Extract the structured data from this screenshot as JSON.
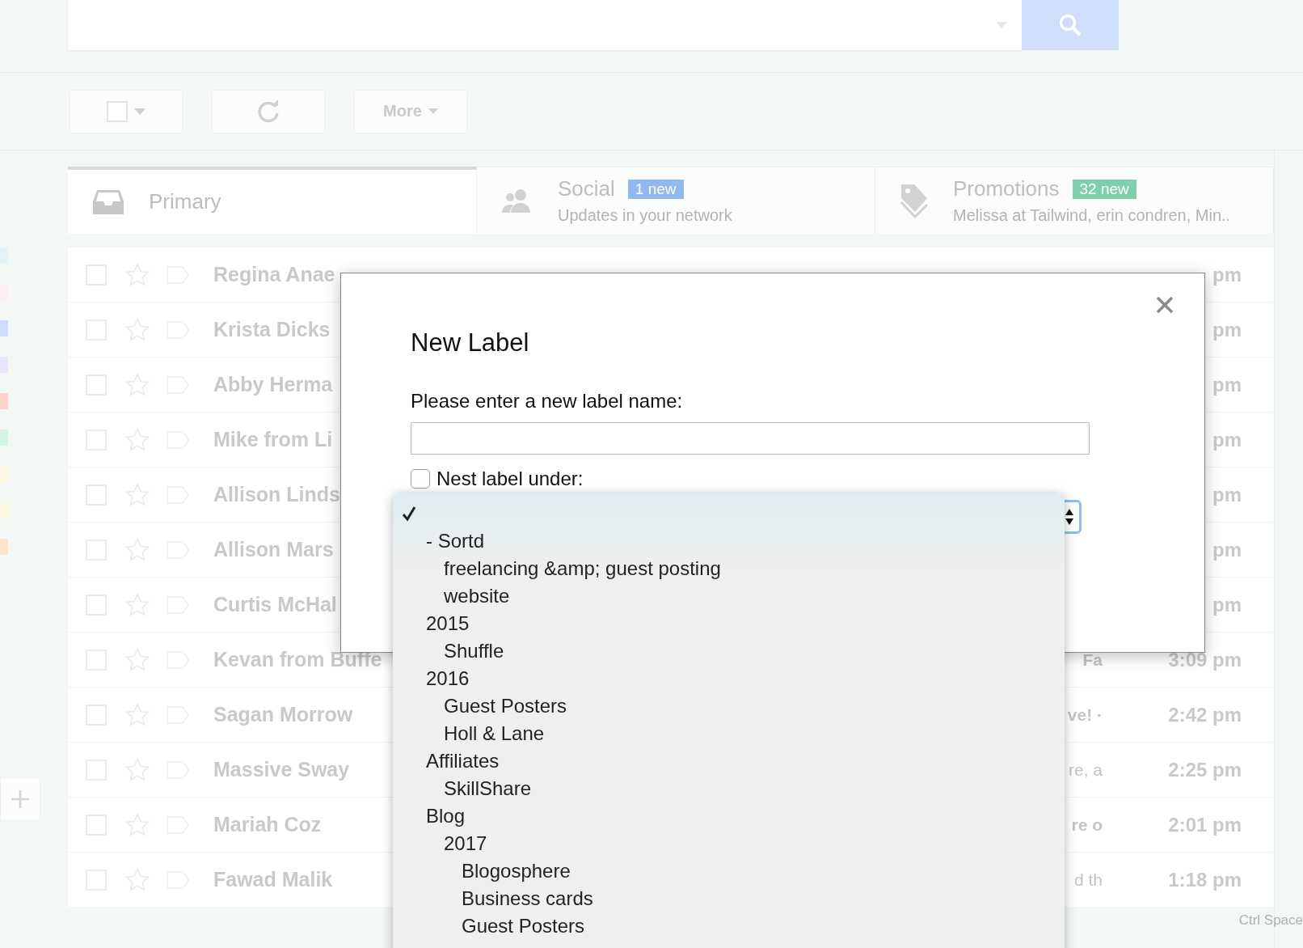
{
  "toolbar": {
    "more_button": "More"
  },
  "sidebar": {
    "labels": [
      {
        "color": "#e3f3fa"
      },
      {
        "color": "#fdeef4"
      },
      {
        "color": "#cfdcf8"
      },
      {
        "color": "#e9e3fb"
      },
      {
        "color": "#fdd1cc"
      },
      {
        "color": "#d3f3e5"
      },
      {
        "color": "#fdf6dd"
      },
      {
        "color": "#fdf7df"
      },
      {
        "color": "#fde3cc"
      }
    ]
  },
  "tabs": [
    {
      "kind": "inbox",
      "label": "Primary",
      "selected": true
    },
    {
      "kind": "people",
      "label": "Social",
      "badge": "1 new",
      "subtitle": "Updates in your network",
      "selected": false
    },
    {
      "kind": "tag",
      "label": "Promotions",
      "badge": "32 new",
      "subtitle": "Melissa at Tailwind, erin condren, Min..",
      "selected": false
    }
  ],
  "messages": [
    {
      "sender": "Regina Anae",
      "time": "pm",
      "checked": false,
      "starred": false
    },
    {
      "sender": "Krista Dicks",
      "time": "pm",
      "checked": false,
      "starred": false
    },
    {
      "sender": "Abby Herma",
      "time": "pm",
      "checked": false,
      "starred": false
    },
    {
      "sender": "Mike from Li",
      "time": "pm",
      "checked": false,
      "starred": false
    },
    {
      "sender": "Allison Linds",
      "time": "pm",
      "checked": false,
      "starred": false
    },
    {
      "sender": "Allison Mars",
      "time": "pm",
      "checked": false,
      "starred": false
    },
    {
      "sender": "Curtis McHal",
      "time": "pm",
      "checked": false,
      "starred": false
    },
    {
      "sender": "Kevan from Buffe",
      "subject": "Fa",
      "time": "3:09 pm",
      "checked": false,
      "starred": false,
      "unread": true
    },
    {
      "sender": "Sagan Morrow",
      "subject": "ve! ·",
      "time": "2:42 pm",
      "checked": false,
      "starred": false,
      "unread": true
    },
    {
      "sender": "Massive Sway",
      "subject": "re, a",
      "time": "2:25 pm",
      "checked": false,
      "starred": false,
      "unread": false
    },
    {
      "sender": "Mariah Coz",
      "subject": "re o",
      "time": "2:01 pm",
      "checked": false,
      "starred": false,
      "unread": true
    },
    {
      "sender": "Fawad Malik",
      "subject": "d th",
      "time": "1:18 pm",
      "checked": false,
      "starred": false,
      "unread": false
    }
  ],
  "footer": {
    "hint": "Ctrl Space"
  },
  "dialog": {
    "title": "New Label",
    "prompt": "Please enter a new label name:",
    "nest_checkbox": {
      "label": "Nest label under:",
      "checked": false
    },
    "dropdown": {
      "items": [
        {
          "selected": true
        },
        {
          "label": "- Sortd",
          "selected": false,
          "children": [
            {
              "label": "freelancing &amp; guest posting",
              "selected": false
            },
            {
              "label": "website",
              "selected": false
            }
          ]
        },
        {
          "label": "2015",
          "selected": false,
          "children": [
            {
              "label": "Shuffle",
              "selected": false
            }
          ]
        },
        {
          "label": "2016",
          "selected": false,
          "children": [
            {
              "label": "Guest Posters",
              "selected": false
            },
            {
              "label": "Holl & Lane",
              "selected": false
            }
          ]
        },
        {
          "label": "Affiliates",
          "selected": false,
          "children": [
            {
              "label": "SkillShare",
              "selected": false
            }
          ]
        },
        {
          "label": "Blog",
          "selected": false,
          "children": [
            {
              "label": "2017",
              "selected": false,
              "children": [
                {
                  "label": "Blogosphere",
                  "selected": false
                },
                {
                  "label": "Business cards",
                  "selected": false
                },
                {
                  "label": "Guest Posters",
                  "selected": false
                }
              ]
            }
          ]
        }
      ]
    }
  }
}
